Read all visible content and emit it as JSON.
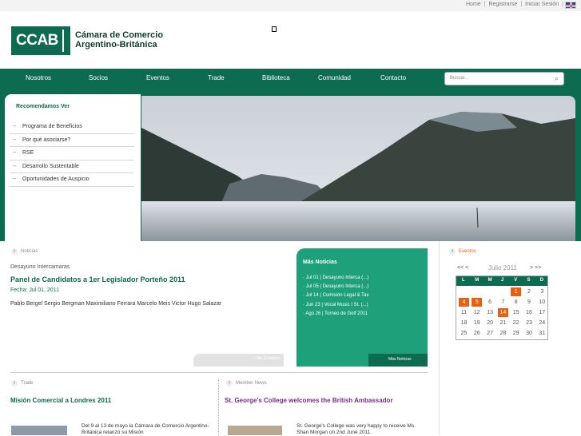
{
  "top_links": [
    "Home",
    "Registrarse",
    "Iniciar Sesión"
  ],
  "logo": {
    "mark": "CCAB",
    "line1": "Cámara de Comercio",
    "line2": "Argentino-Británica"
  },
  "nav": [
    "Nosotros",
    "Socios",
    "Eventos",
    "Trade",
    "Biblioteca",
    "Comunidad",
    "Contacto"
  ],
  "search": {
    "placeholder": "Buscar..."
  },
  "sidebar": {
    "heading": "Recomendamos Ver",
    "items": [
      "Programa de Beneficios",
      "Por qué asociarse?",
      "RSE",
      "Desarrollo Sustentable",
      "Oportunidades de Auspicio"
    ]
  },
  "news": {
    "label": "Noticias",
    "category": "Desayuno Intercamaras",
    "title": "Panel de Candidatos a 1er Legislador Porteño 2011",
    "date": "Fecha: Jul 01, 2011",
    "body": "Pablo Bergel Sergio Bergman Maximiliano Ferrara Marcelo Meis Victor Hugo Salazar",
    "more": "» Ver Completo"
  },
  "mas_noticias": {
    "heading": "Más Noticias",
    "items": [
      "Jul 01 | Desayuno Interca (...)",
      "Jul 05 | Desayuno Interca (...)",
      "Jul 14 | Comisión Legal & Tax",
      "Jun 23 | Vocal Music I St. (...)",
      "Ago 26 | Torneo de Golf 2011"
    ],
    "footer": "Más Noticias"
  },
  "events": {
    "label": "Eventos",
    "prev": "<< <",
    "month": "Julio 2011",
    "next": "> >>",
    "weekdays": [
      "L",
      "M",
      "M",
      "J",
      "V",
      "S",
      "D"
    ],
    "rows": [
      [
        "",
        "",
        "",
        "",
        "1",
        "2",
        "3"
      ],
      [
        "4",
        "5",
        "6",
        "7",
        "8",
        "9",
        "10"
      ],
      [
        "11",
        "12",
        "13",
        "14",
        "15",
        "16",
        "17"
      ],
      [
        "18",
        "19",
        "20",
        "21",
        "22",
        "23",
        "24"
      ],
      [
        "25",
        "26",
        "27",
        "28",
        "29",
        "30",
        "31"
      ]
    ],
    "highlighted": [
      "1",
      "4",
      "5",
      "14"
    ],
    "highlight_color": "#e95f12"
  },
  "trade": {
    "label": "Trade",
    "title": "Misión Comercial a Londres 2011",
    "text": "Del 9 al 13 de mayo la Cámara de Comercio Argentino-Británica relanzó su Misión"
  },
  "member_news": {
    "label": "Member News",
    "title": "St. George's College welcomes the British Ambassador",
    "text": "St. George's College was very happy to receive Ms. Shan Morgan on 2nd June 2011."
  },
  "colors": {
    "brand": "#0d6b50",
    "accent": "#1ea07a",
    "events_highlight": "#e95f12"
  }
}
